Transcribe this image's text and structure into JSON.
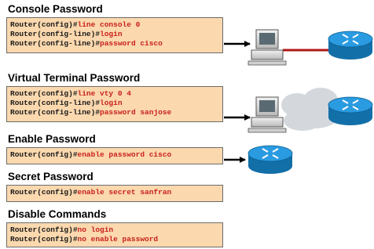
{
  "sections": [
    {
      "heading": "Console Password",
      "lines": [
        {
          "prompt": "Router(config)#",
          "command": "line console 0"
        },
        {
          "prompt": "Router(config-line)#",
          "command": "login"
        },
        {
          "prompt": "Router(config-line)#",
          "command": "password cisco"
        }
      ]
    },
    {
      "heading": "Virtual Terminal Password",
      "lines": [
        {
          "prompt": "Router(config)#",
          "command": "line vty 0 4"
        },
        {
          "prompt": "Router(config-line)#",
          "command": "login"
        },
        {
          "prompt": "Router(config-line)#",
          "command": "password sanjose"
        }
      ]
    },
    {
      "heading": "Enable Password",
      "lines": [
        {
          "prompt": "Router(config)#",
          "command": "enable password cisco"
        }
      ]
    },
    {
      "heading": "Secret Password",
      "lines": [
        {
          "prompt": "Router(config)#",
          "command": "enable secret sanfran"
        }
      ]
    },
    {
      "heading": "Disable Commands",
      "lines": [
        {
          "prompt": "Router(config)#",
          "command": "no login"
        },
        {
          "prompt": "Router(config)#",
          "command": "no enable password"
        }
      ]
    }
  ],
  "colors": {
    "box_fill": "#fbd8ae",
    "box_border": "#6b6b6b",
    "prompt_text": "#1a1a1a",
    "command_text": "#c8201c",
    "router_fill": "#1e8fd0",
    "console_cable": "#b01818",
    "cloud_fill": "#d4d8dc"
  },
  "icons": [
    "router-icon",
    "pc-terminal-icon",
    "network-cloud-icon",
    "arrow-icon"
  ]
}
